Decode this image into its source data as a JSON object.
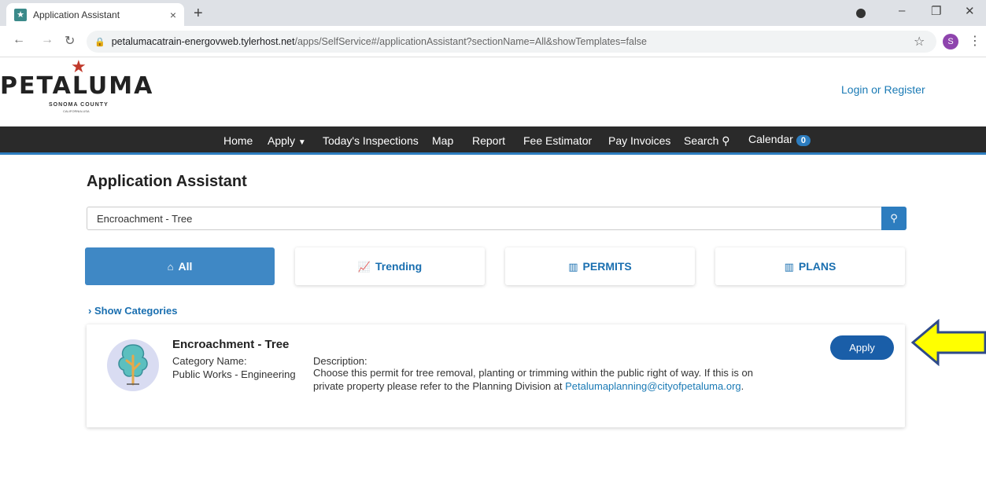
{
  "browser": {
    "tab_title": "Application Assistant",
    "tab_close": "×",
    "new_tab": "+",
    "url_host": "petalumacatrain-energovweb.tylerhost.net",
    "url_path": "/apps/SelfService#/applicationAssistant?sectionName=All&showTemplates=false",
    "profile_initial": "S",
    "icons": [
      "back-icon",
      "forward-icon",
      "reload-icon",
      "lock-icon",
      "star-icon",
      "menu-icon"
    ]
  },
  "header": {
    "logo_text": "PETALUMA",
    "logo_subtext": "SONOMA COUNTY",
    "logo_subtext2": "CALIFORNIA-USA",
    "login_link": "Login or Register"
  },
  "nav": {
    "items": [
      "Home",
      "Apply",
      "Today's Inspections",
      "Map",
      "Report",
      "Fee Estimator",
      "Pay Invoices",
      "Search",
      "Calendar"
    ],
    "calendar_badge": "0"
  },
  "main": {
    "title": "Application Assistant",
    "search_value": "Encroachment - Tree",
    "filters": [
      "All",
      "Trending",
      "PERMITS",
      "PLANS"
    ],
    "active_filter": "All",
    "show_categories": "Show Categories"
  },
  "result": {
    "name": "Encroachment - Tree",
    "category_label": "Category Name:",
    "category_value": "Public Works - Engineering",
    "description_label": "Description:",
    "description_text": "Choose this permit for tree removal, planting or trimming within the public right of way. If this is on private property please refer to the Planning Division at",
    "description_email": "Petalumaplanning@cityofpetaluma.org",
    "description_end": ".",
    "apply_label": "Apply"
  },
  "colors": {
    "nav_bg": "#2a2a2a",
    "accent": "#2d7dbf",
    "apply_button": "#1a5ea8",
    "annotation_arrow_fill": "#ffff00",
    "annotation_arrow_border": "#2e4a8a"
  }
}
